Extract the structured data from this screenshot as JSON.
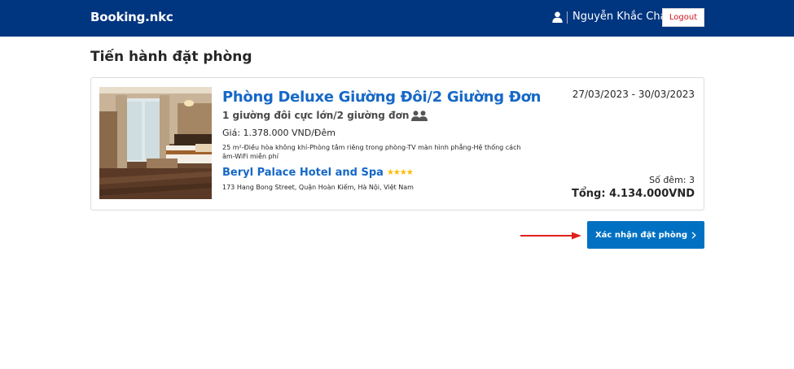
{
  "header": {
    "brand": "Booking.nkc",
    "user_name": "Nguyễn Khắc Cháng",
    "logout_label": "Logout",
    "user_icon": "person-icon"
  },
  "page": {
    "title": "Tiến hành đặt phòng"
  },
  "booking": {
    "room_name": "Phòng Deluxe Giường Đôi/2 Giường Đơn",
    "bed_info": "1 giường đôi cực lớn/2 giường đơn",
    "price": "Giá: 1.378.000 VND/Đêm",
    "amenities": "25 m²-Điều hòa không khí-Phòng tắm riêng trong phòng-TV màn hình phẳng-Hệ thống cách âm-WiFi miễn phí",
    "hotel_name": "Beryl Palace Hotel and Spa",
    "stars": "★★★★",
    "star_count": 4,
    "address": "173 Hang Bong Street, Quận Hoàn Kiếm, Hà Nội, Việt Nam",
    "dates": "27/03/2023 - 30/03/2023",
    "nights": "Số đêm: 3",
    "total": "Tổng: 4.134.000VND"
  },
  "actions": {
    "confirm_label": "Xác nhận đặt phòng"
  },
  "colors": {
    "header_bg": "#003580",
    "primary_blue": "#0071c2",
    "link_blue": "#1668c7",
    "star_yellow": "#febb02",
    "logout_red": "#d4111e",
    "arrow_red": "#e0201b"
  }
}
